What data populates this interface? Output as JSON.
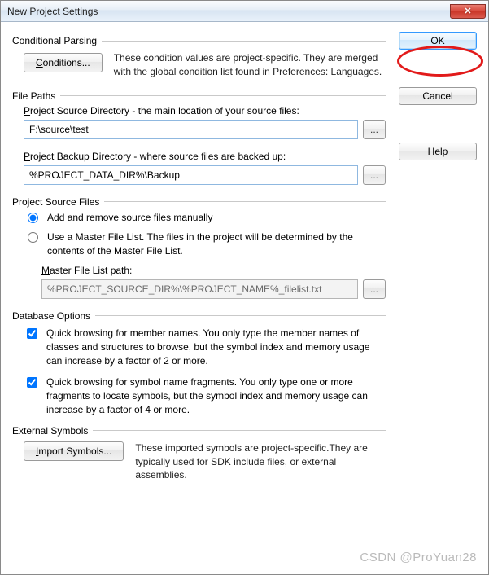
{
  "window": {
    "title": "New Project Settings",
    "close_glyph": "✕"
  },
  "right_buttons": {
    "ok": "OK",
    "cancel": "Cancel",
    "help": "Help",
    "help_u": "H"
  },
  "conditional": {
    "legend": "Conditional Parsing",
    "button_label": "Conditions...",
    "button_u": "C",
    "desc": "These condition values are project-specific.  They are merged with the global condition list found in Preferences: Languages."
  },
  "file_paths": {
    "legend": "File Paths",
    "source_label_pre": "P",
    "source_label": "roject Source Directory - the main location of your source files:",
    "source_value": "F:\\source\\test",
    "backup_label_pre": "P",
    "backup_label": "roject Backup Directory - where source files are backed up:",
    "backup_value": "%PROJECT_DATA_DIR%\\Backup",
    "browse_glyph": "..."
  },
  "source_files": {
    "legend": "Project Source Files",
    "radio_add_u": "A",
    "radio_add": "dd and remove source files manually",
    "radio_master": "Use a Master File List. The files in the project will be determined by the contents of the Master File List.",
    "master_label_u": "M",
    "master_label": "aster File List path:",
    "master_value": "%PROJECT_SOURCE_DIR%\\%PROJECT_NAME%_filelist.txt",
    "browse_glyph": "..."
  },
  "database": {
    "legend": "Database Options",
    "opt1": "Quick browsing for member names.  You only type the member names of classes and structures to browse, but the symbol index and memory usage can increase by a factor of 2 or more.",
    "opt2": "Quick browsing for symbol name fragments.  You only type one or more fragments to locate symbols, but the symbol index and memory usage can increase by a factor of 4 or more."
  },
  "external": {
    "legend": "External Symbols",
    "button_u": "I",
    "button_label": "mport Symbols...",
    "desc": "These imported symbols are project-specific.They are typically used for SDK include files, or external assemblies."
  },
  "watermark": "CSDN @ProYuan28"
}
